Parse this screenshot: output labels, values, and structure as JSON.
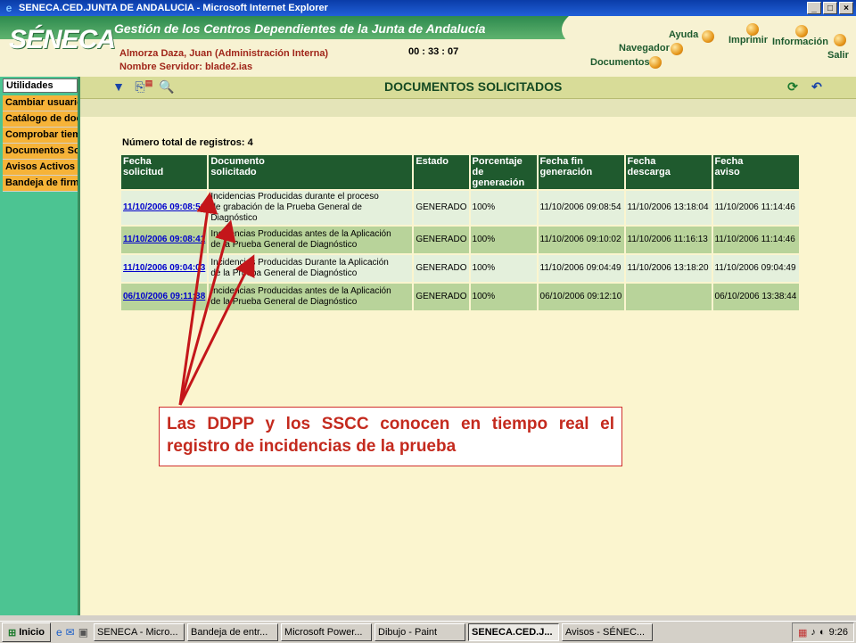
{
  "window": {
    "title": "SENECA.CED.JUNTA DE ANDALUCIA - Microsoft Internet Explorer",
    "min": "_",
    "max": "□",
    "close": "×"
  },
  "header": {
    "logo": "SÉNECA",
    "subtitle": "Gestión de los Centros Dependientes de la Junta de Andalucía",
    "user": "Almorza Daza, Juan (Administración Interna)",
    "server": "Nombre Servidor: blade2.ias",
    "clock": "00 : 33 : 07",
    "nav": {
      "ayuda": "Ayuda",
      "imprimir": "Imprimir",
      "informacion": "Información",
      "navegador": "Navegador",
      "documentos": "Documentos",
      "salir": "Salir"
    }
  },
  "sidebar": {
    "title": "Utilidades",
    "items": [
      "Cambiar usuario",
      "Catálogo de doc",
      "Comprobar tiem",
      "Documentos So",
      "Avisos Activos",
      "Bandeja de firm"
    ]
  },
  "toolbar": {
    "title": "DOCUMENTOS SOLICITADOS"
  },
  "list": {
    "total_label": "Número total de registros: 4",
    "headers": [
      [
        "Fecha",
        "solicitud"
      ],
      [
        "Documento",
        "solicitado"
      ],
      [
        "Estado",
        ""
      ],
      [
        "Porcentaje de",
        "generación"
      ],
      [
        "Fecha fin",
        "generación"
      ],
      [
        "Fecha",
        "descarga"
      ],
      [
        "Fecha",
        "aviso"
      ]
    ],
    "rows": [
      {
        "fecha": "11/10/2006 09:08:51",
        "doc1": "Incidencias Producidas durante el proceso",
        "doc2": "de grabación de la Prueba General de Diagnóstico",
        "estado": "GENERADO",
        "pct": "100%",
        "fin": "11/10/2006 09:08:54",
        "descarga": "11/10/2006 13:18:04",
        "aviso": "11/10/2006 11:14:46"
      },
      {
        "fecha": "11/10/2006 09:08:41",
        "doc1": "Incidencias Producidas antes de la Aplicación",
        "doc2": "de la Prueba General de Diagnóstico",
        "estado": "GENERADO",
        "pct": "100%",
        "fin": "11/10/2006 09:10:02",
        "descarga": "11/10/2006 11:16:13",
        "aviso": "11/10/2006 11:14:46"
      },
      {
        "fecha": "11/10/2006 09:04:03",
        "doc1": "Incidencias Producidas Durante la Aplicación",
        "doc2": "de la Prueba General de Diagnóstico",
        "estado": "GENERADO",
        "pct": "100%",
        "fin": "11/10/2006 09:04:49",
        "descarga": "11/10/2006 13:18:20",
        "aviso": "11/10/2006 09:04:49"
      },
      {
        "fecha": "06/10/2006 09:11:38",
        "doc1": "Incidencias Producidas antes de la Aplicación",
        "doc2": "de la Prueba General de Diagnóstico",
        "estado": "GENERADO",
        "pct": "100%",
        "fin": "06/10/2006 09:12:10",
        "descarga": "",
        "aviso": "06/10/2006 13:38:44"
      }
    ]
  },
  "callout": "Las DDPP y los SSCC conocen en tiempo real el registro de incidencias de la prueba",
  "taskbar": {
    "start": "Inicio",
    "tasks": [
      "SENECA - Micro...",
      "Bandeja de entr...",
      "Microsoft Power...",
      "Dibujo - Paint",
      "SENECA.CED.J...",
      "Avisos - SÉNEC..."
    ],
    "time": "9:26"
  }
}
